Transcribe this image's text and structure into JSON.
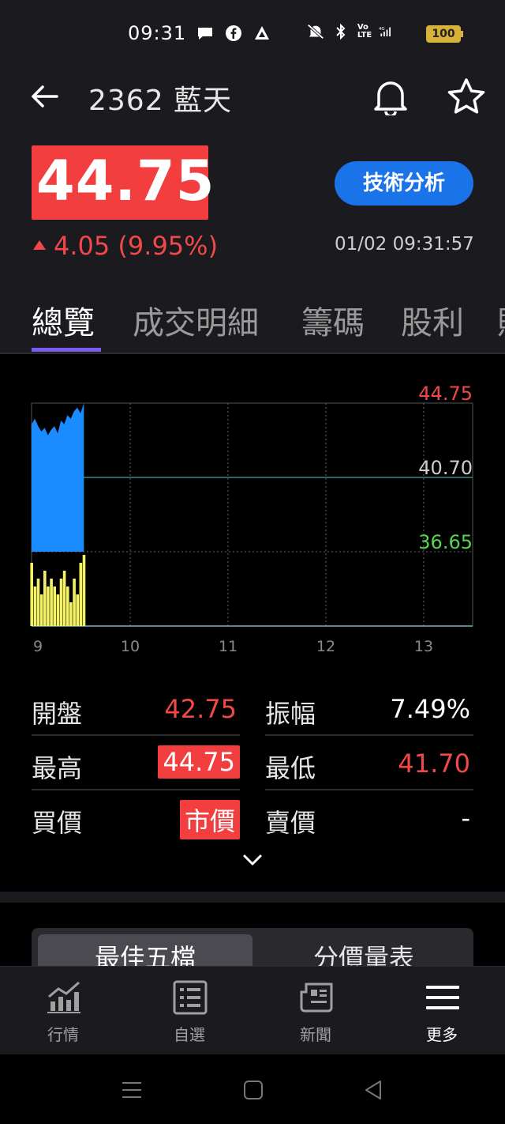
{
  "status_bar": {
    "time": "09:31",
    "battery": "100",
    "icons": [
      "chat-icon",
      "facebook-icon",
      "app-icon",
      "mute-icon",
      "bluetooth-icon",
      "volte-icon",
      "signal-icon",
      "battery-icon"
    ]
  },
  "header": {
    "title": "2362 藍天",
    "price": "44.75",
    "change": "4.05 (9.95%)",
    "timestamp": "01/02 09:31:57",
    "tech_button": "技術分析"
  },
  "tabs": [
    "總覽",
    "成交明細",
    "籌碼",
    "股利"
  ],
  "chart_data": {
    "type": "area",
    "price_labels": [
      "44.75",
      "40.70",
      "36.65"
    ],
    "x_labels": [
      "9",
      "10",
      "11",
      "12",
      "13"
    ],
    "reference_price": 40.7,
    "ylim": [
      36.65,
      44.75
    ],
    "price_x_minutes": [
      0,
      2,
      4,
      6,
      8,
      10,
      12,
      14,
      16,
      18,
      20,
      22,
      24,
      26,
      28,
      30,
      32
    ],
    "price_values": [
      43.6,
      43.9,
      43.5,
      43.2,
      43.4,
      43.0,
      43.3,
      43.5,
      43.1,
      43.8,
      43.6,
      44.1,
      43.9,
      44.3,
      44.5,
      44.2,
      44.75
    ],
    "volume_values": [
      8,
      5,
      6,
      4,
      7,
      5,
      6,
      5,
      4,
      6,
      7,
      5,
      3,
      6,
      4,
      8,
      9
    ],
    "colors": {
      "price_area": "#1a8cff",
      "volume": "#f2f264",
      "up": "#f24848",
      "down": "#54d64e",
      "reference": "#2f8c8c"
    }
  },
  "stats": {
    "open_label": "開盤",
    "open": "42.75",
    "amp_label": "振幅",
    "amp": "7.49%",
    "high_label": "最高",
    "high": "44.75",
    "low_label": "最低",
    "low": "41.70",
    "bid_label": "買價",
    "bid": "市價",
    "ask_label": "賣價",
    "ask": "-"
  },
  "lower_tabs": [
    "最佳五檔",
    "分價量表"
  ],
  "bottom_nav": [
    {
      "label": "行情",
      "icon": "chart-icon"
    },
    {
      "label": "自選",
      "icon": "list-icon"
    },
    {
      "label": "新聞",
      "icon": "news-icon"
    },
    {
      "label": "更多",
      "icon": "menu-icon"
    }
  ]
}
